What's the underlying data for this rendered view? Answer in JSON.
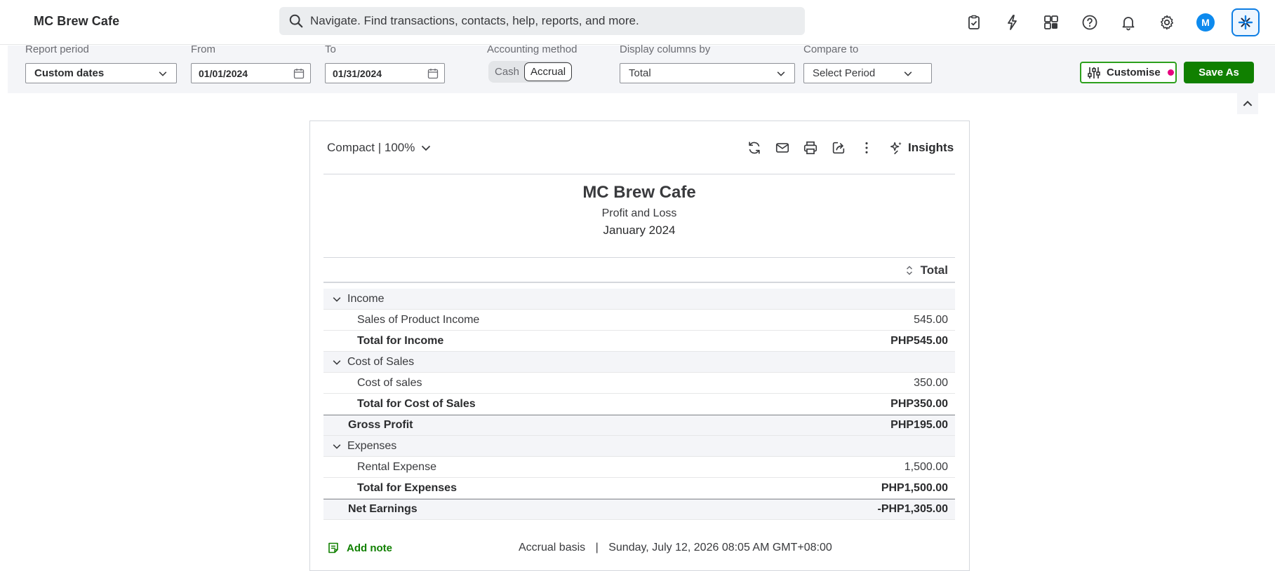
{
  "app": {
    "company_name": "MC Brew Cafe",
    "search_placeholder": "Navigate. Find transactions, contacts, help, reports, and more.",
    "avatar_initial": "M",
    "colors": {
      "accent": "#2ca01c",
      "primary_button": "#108000",
      "avatar": "#0d8aee",
      "notification_dot": "#e6007e"
    },
    "top_icons": [
      "clipboard-check-icon",
      "lightning-icon",
      "apps-icon",
      "help-icon",
      "bell-icon",
      "gear-icon",
      "avatar",
      "ai-assistant-icon"
    ]
  },
  "filters": {
    "report_period": {
      "label": "Report period",
      "value": "Custom dates"
    },
    "from": {
      "label": "From",
      "value": "01/01/2024"
    },
    "to": {
      "label": "To",
      "value": "01/31/2024"
    },
    "accounting_method": {
      "label": "Accounting method",
      "options": [
        "Cash",
        "Accrual"
      ],
      "selected": "Accrual"
    },
    "display_columns": {
      "label": "Display columns by",
      "value": "Total"
    },
    "compare_to": {
      "label": "Compare to",
      "value": "Select Period"
    },
    "customise_label": "Customise",
    "save_as_label": "Save As"
  },
  "toolbar": {
    "density_label": "Compact | 100%",
    "insights_label": "Insights",
    "icons": [
      "refresh-icon",
      "email-icon",
      "print-icon",
      "export-icon",
      "more-options-icon",
      "insights-icon"
    ]
  },
  "report": {
    "company": "MC Brew Cafe",
    "title": "Profit and Loss",
    "period": "January 2024",
    "column_header": "Total",
    "rows": [
      {
        "type": "section",
        "label": "Income",
        "amount": ""
      },
      {
        "type": "item",
        "label": "Sales of Product Income",
        "amount": "545.00"
      },
      {
        "type": "total",
        "label": "Total for Income",
        "amount": "PHP545.00"
      },
      {
        "type": "section",
        "label": "Cost of Sales",
        "amount": ""
      },
      {
        "type": "item",
        "label": "Cost of sales",
        "amount": "350.00"
      },
      {
        "type": "total",
        "label": "Total for Cost of Sales",
        "amount": "PHP350.00"
      },
      {
        "type": "summary",
        "label": "Gross Profit",
        "amount": "PHP195.00"
      },
      {
        "type": "section",
        "label": "Expenses",
        "amount": ""
      },
      {
        "type": "item",
        "label": "Rental Expense",
        "amount": "1,500.00"
      },
      {
        "type": "total",
        "label": "Total for Expenses",
        "amount": "PHP1,500.00"
      },
      {
        "type": "summary",
        "label": "Net Earnings",
        "amount": "-PHP1,305.00"
      }
    ]
  },
  "footer": {
    "add_note_label": "Add note",
    "basis": "Accrual basis",
    "separator": "|",
    "timestamp": "Sunday, July 12, 2026 08:05 AM GMT+08:00"
  }
}
